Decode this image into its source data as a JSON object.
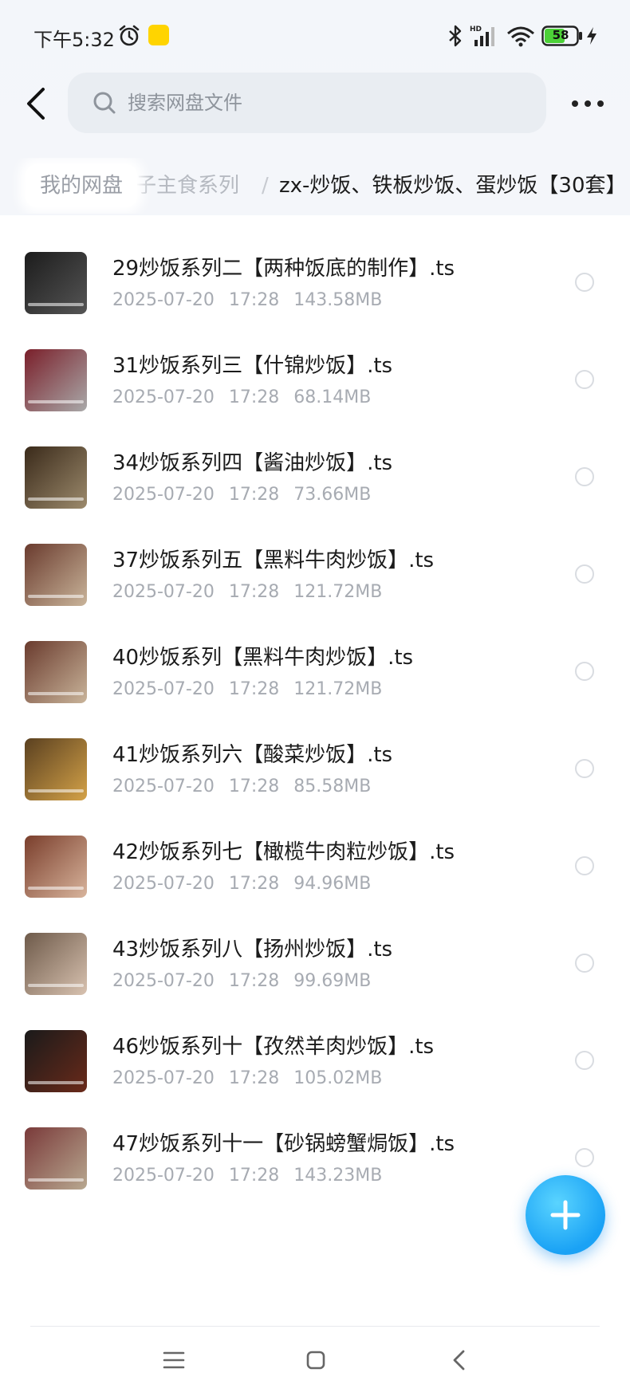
{
  "status_bar": {
    "time": "下午5:32",
    "battery": "58",
    "network": "HD"
  },
  "search": {
    "placeholder": "搜索网盘文件"
  },
  "breadcrumb": {
    "root": "我的网盘",
    "mid": "子主食系列",
    "current": "zx-炒饭、铁板炒饭、蛋炒饭【30套】"
  },
  "files": [
    {
      "name": "29炒饭系列二【两种饭底的制作】.ts",
      "date": "2025-07-20",
      "time": "17:28",
      "size": "143.58MB",
      "thumb_colors": [
        "#1c1c1c",
        "#555555"
      ]
    },
    {
      "name": "31炒饭系列三【什锦炒饭】.ts",
      "date": "2025-07-20",
      "time": "17:28",
      "size": "68.14MB",
      "thumb_colors": [
        "#7a1f2a",
        "#a9a9a9"
      ]
    },
    {
      "name": "34炒饭系列四【酱油炒饭】.ts",
      "date": "2025-07-20",
      "time": "17:28",
      "size": "73.66MB",
      "thumb_colors": [
        "#3a2a1a",
        "#9c8a6c"
      ]
    },
    {
      "name": "37炒饭系列五【黑料牛肉炒饭】.ts",
      "date": "2025-07-20",
      "time": "17:28",
      "size": "121.72MB",
      "thumb_colors": [
        "#6a3b2e",
        "#c9b49a"
      ]
    },
    {
      "name": "40炒饭系列【黑料牛肉炒饭】.ts",
      "date": "2025-07-20",
      "time": "17:28",
      "size": "121.72MB",
      "thumb_colors": [
        "#6a3b2e",
        "#c9b49a"
      ]
    },
    {
      "name": "41炒饭系列六【酸菜炒饭】.ts",
      "date": "2025-07-20",
      "time": "17:28",
      "size": "85.58MB",
      "thumb_colors": [
        "#5a4020",
        "#d4a248"
      ]
    },
    {
      "name": "42炒饭系列七【橄榄牛肉粒炒饭】.ts",
      "date": "2025-07-20",
      "time": "17:28",
      "size": "94.96MB",
      "thumb_colors": [
        "#7a3e2c",
        "#d8b49c"
      ]
    },
    {
      "name": "43炒饭系列八【扬州炒饭】.ts",
      "date": "2025-07-20",
      "time": "17:28",
      "size": "99.69MB",
      "thumb_colors": [
        "#6e5a4a",
        "#d8c2b0"
      ]
    },
    {
      "name": "46炒饭系列十【孜然羊肉炒饭】.ts",
      "date": "2025-07-20",
      "time": "17:28",
      "size": "105.02MB",
      "thumb_colors": [
        "#1a1a1a",
        "#6a2a1a"
      ]
    },
    {
      "name": "47炒饭系列十一【砂锅螃蟹焗饭】.ts",
      "date": "2025-07-20",
      "time": "17:28",
      "size": "143.23MB",
      "thumb_colors": [
        "#7a3a3a",
        "#b8a890"
      ]
    }
  ],
  "colors": {
    "accent": "#1aa2f5",
    "meta": "#a7abb2",
    "search_bg": "#e9edf2"
  },
  "icons": [
    "alarm-icon",
    "bluetooth-icon",
    "signal-icon",
    "wifi-icon",
    "battery-icon",
    "charge-icon",
    "back-icon",
    "search-icon",
    "more-icon",
    "plus-icon",
    "menu-icon",
    "home-icon",
    "nav-back-icon"
  ]
}
